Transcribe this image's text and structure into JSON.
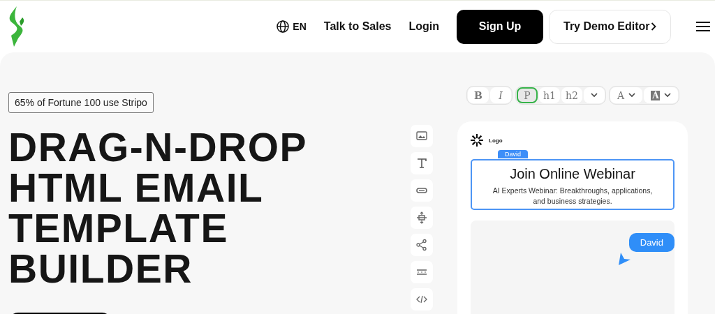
{
  "header": {
    "language": "EN",
    "links": [
      "Talk to Sales",
      "Login"
    ],
    "primary_button": "Sign Up",
    "secondary_button": "Try Demo Editor"
  },
  "hero": {
    "badge": "65% of Fortune 100 use Stripo",
    "headline": [
      "DRAG-N-DROP",
      "HTML EMAIL",
      "TEMPLATE",
      "BUILDER"
    ]
  },
  "editor": {
    "toolbar": [
      [
        {
          "kind": "bold",
          "label": "B",
          "selected": false
        },
        {
          "kind": "italic",
          "label": "I",
          "selected": false
        }
      ],
      [
        {
          "kind": "text",
          "label": "P",
          "selected": true
        },
        {
          "kind": "text",
          "label": "h1",
          "selected": false
        },
        {
          "kind": "text",
          "label": "h2",
          "selected": false
        },
        {
          "kind": "caret",
          "selected": false
        }
      ],
      [
        {
          "kind": "color",
          "label": "A",
          "selected": false
        },
        {
          "kind": "highlight",
          "label": "A",
          "selected": false
        }
      ]
    ],
    "logo_label": "Logo",
    "editor_tag": "David",
    "title": "Join Online Webinar",
    "subtitle": "AI Experts Webinar: Breakthroughs, applications, and business strategies.",
    "cursor_label": "David"
  }
}
